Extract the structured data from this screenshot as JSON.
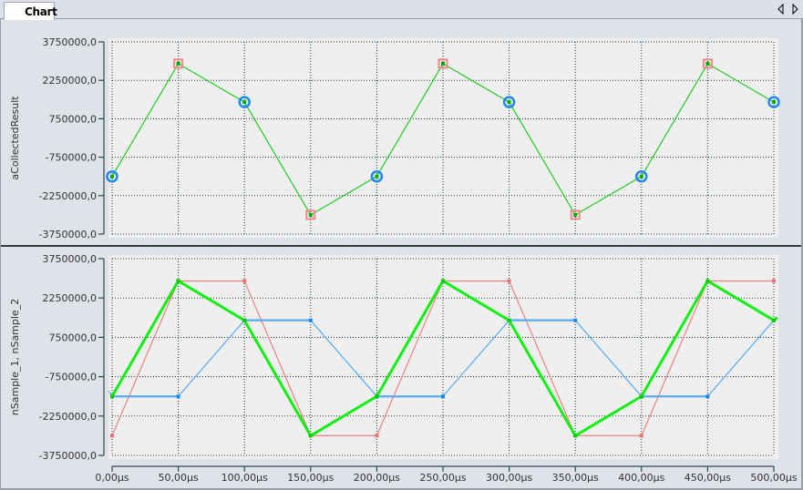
{
  "tab": {
    "label": "Chart"
  },
  "nav": {
    "prev": "previous-tab",
    "next": "next-tab"
  },
  "colors": {
    "result": "#22cc22",
    "result_bold": "#11ee11",
    "nsample1": "#f08080",
    "nsample2": "#55aaf0",
    "marker_circle": "#1e88ee",
    "marker_square": "#f08a8a",
    "grid": "#1a3a3a",
    "plot_bg": "#efefef",
    "axis": "#2a4a4a"
  },
  "chart_data": [
    {
      "type": "line",
      "title": "",
      "ylabel": "aCollectedResult",
      "xlabel": "",
      "ylim": [
        -3750000,
        3750000
      ],
      "yticks": [
        3750000,
        2250000,
        750000,
        -750000,
        -2250000,
        -3750000
      ],
      "ytick_labels": [
        "3750000,0",
        "2250000,0",
        "750000,0",
        "-750000,0",
        "-2250000,0",
        "-3750000,0"
      ],
      "grid": true,
      "x": [
        0,
        50,
        100,
        150,
        200,
        250,
        300,
        350,
        400,
        450,
        500
      ],
      "series": [
        {
          "name": "aCollectedResult",
          "values": [
            -1500000,
            2900000,
            1400000,
            -3000000,
            -1500000,
            2900000,
            1400000,
            -3000000,
            -1500000,
            2900000,
            1400000
          ],
          "markers": [
            "circle",
            "square",
            "circle",
            "square",
            "circle",
            "square",
            "circle",
            "square",
            "circle",
            "square",
            "circle"
          ]
        }
      ]
    },
    {
      "type": "line",
      "title": "",
      "ylabel": "nSample_1, nSample_2",
      "xlabel": "",
      "ylim": [
        -3750000,
        3750000
      ],
      "yticks": [
        3750000,
        2250000,
        750000,
        -750000,
        -2250000,
        -3750000
      ],
      "ytick_labels": [
        "3750000,0",
        "2250000,0",
        "750000,0",
        "-750000,0",
        "-2250000,0",
        "-3750000,0"
      ],
      "xlim": [
        0,
        500
      ],
      "xticks": [
        0,
        50,
        100,
        150,
        200,
        250,
        300,
        350,
        400,
        450,
        500
      ],
      "xtick_labels": [
        "0,00µs",
        "50,00µs",
        "100,00µs",
        "150,00µs",
        "200,00µs",
        "250,00µs",
        "300,00µs",
        "350,00µs",
        "400,00µs",
        "450,00µs",
        "500,00µs"
      ],
      "grid": true,
      "x": [
        0,
        50,
        100,
        150,
        200,
        250,
        300,
        350,
        400,
        450,
        500
      ],
      "series": [
        {
          "name": "nSample_1",
          "values": [
            -3000000,
            2900000,
            2900000,
            -3000000,
            -3000000,
            2900000,
            2900000,
            -3000000,
            -3000000,
            2900000,
            2900000
          ]
        },
        {
          "name": "nSample_2",
          "values": [
            -1500000,
            -1500000,
            1400000,
            1400000,
            -1500000,
            -1500000,
            1400000,
            1400000,
            -1500000,
            -1500000,
            1400000
          ]
        },
        {
          "name": "aCollectedResult",
          "values": [
            -1500000,
            2900000,
            1400000,
            -3000000,
            -1500000,
            2900000,
            1400000,
            -3000000,
            -1500000,
            2900000,
            1400000
          ]
        }
      ]
    }
  ]
}
